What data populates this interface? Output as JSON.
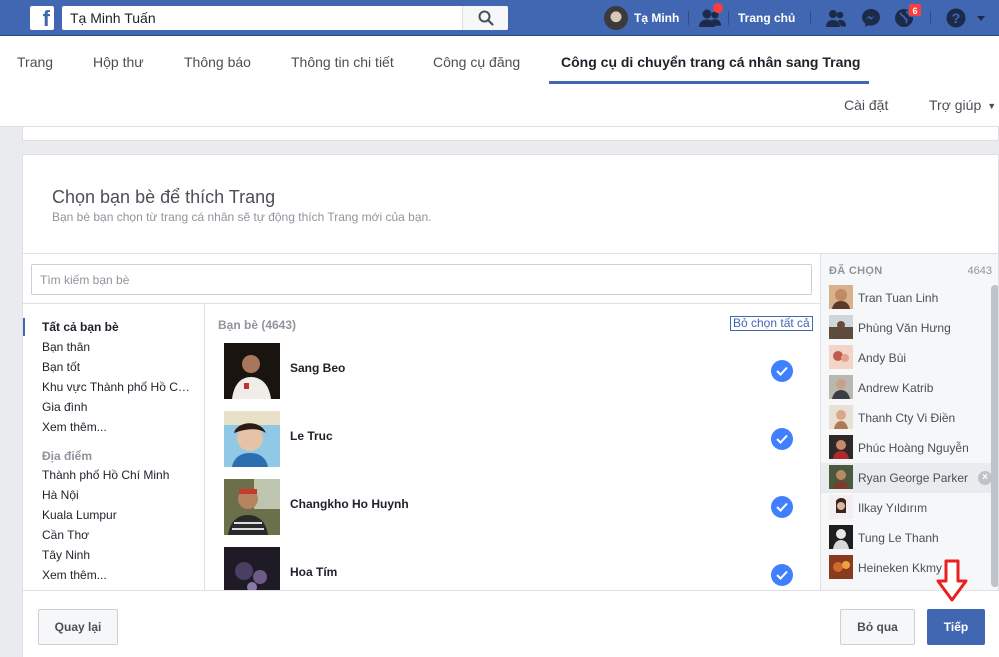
{
  "topbar": {
    "logo": "f",
    "search_value": "Tạ Minh Tuấn",
    "profile_name": "Tạ Minh",
    "home_label": "Trang chủ",
    "notification_count": "6",
    "icons": [
      "search-icon",
      "find-friends-icon",
      "friends-icon",
      "messenger-icon",
      "notifications-globe-icon",
      "help-icon"
    ]
  },
  "pagenav": {
    "tabs": [
      {
        "label": "Trang"
      },
      {
        "label": "Hộp thư"
      },
      {
        "label": "Thông báo"
      },
      {
        "label": "Thông tin chi tiết"
      },
      {
        "label": "Công cụ đăng"
      },
      {
        "label": "Công cụ di chuyển trang cá nhân sang Trang",
        "active": true
      }
    ],
    "settings_label": "Cài đặt",
    "help_label": "Trợ giúp"
  },
  "dialog": {
    "title": "Chọn bạn bè để thích Trang",
    "description": "Bạn bè bạn chọn từ trang cá nhân sẽ tự động thích Trang mới của bạn.",
    "search_placeholder": "Tìm kiếm bạn bè",
    "filters": {
      "groups": [
        "Tất cả bạn bè",
        "Bạn thân",
        "Bạn tốt",
        "Khu vực Thành phố Hồ Chí Minh",
        "Gia đình",
        "Xem thêm..."
      ],
      "places_heading": "Địa điểm",
      "places": [
        "Thành phố Hồ Chí Minh",
        "Hà Nội",
        "Kuala Lumpur",
        "Cần Thơ",
        "Tây Ninh",
        "Xem thêm..."
      ]
    },
    "friends": {
      "heading": "Bạn bè (4643)",
      "deselect_all": "Bỏ chọn tất cả",
      "items": [
        {
          "name": "Sang Beo",
          "selected": true
        },
        {
          "name": "Le Truc",
          "selected": true
        },
        {
          "name": "Changkho Ho Huynh",
          "selected": true
        },
        {
          "name": "Hoa Tím",
          "selected": true
        }
      ]
    },
    "selected_panel": {
      "heading": "ĐÃ CHỌN",
      "count": "4643",
      "items": [
        "Tran Tuan Linh",
        "Phùng Văn Hưng",
        "Andy Bùi",
        "Andrew Katrib",
        "Thanh Cty Vi Điền",
        "Phúc Hoàng Nguyễn",
        "Ryan George Parker",
        "Ilkay Yıldırım",
        "Tung Le Thanh",
        "Heineken Kkmy"
      ]
    },
    "footer": {
      "back_label": "Quay lại",
      "skip_label": "Bỏ qua",
      "next_label": "Tiếp"
    }
  },
  "colors": {
    "brand_blue": "#4267b2",
    "check_blue": "#4080ff",
    "badge_red": "#fa3e3e",
    "annotation_arrow": "#e8201f"
  }
}
